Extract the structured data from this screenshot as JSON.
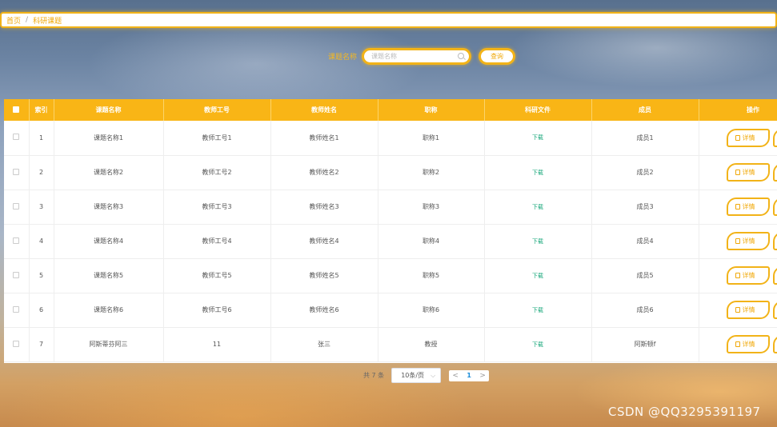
{
  "breadcrumb": {
    "home": "首页",
    "separator": "/",
    "current": "科研课题"
  },
  "search": {
    "label": "课题名称",
    "placeholder": "课题名称",
    "value": "",
    "button": "查询"
  },
  "table": {
    "headers": [
      "索引",
      "课题名称",
      "教师工号",
      "教师姓名",
      "职称",
      "科研文件",
      "成员",
      "操作"
    ],
    "rows": [
      {
        "index": "1",
        "name": "课题名称1",
        "teacher_id": "教师工号1",
        "teacher_name": "教师姓名1",
        "title": "职称1",
        "file": "下载",
        "members": "成员1",
        "detail": "详情"
      },
      {
        "index": "2",
        "name": "课题名称2",
        "teacher_id": "教师工号2",
        "teacher_name": "教师姓名2",
        "title": "职称2",
        "file": "下载",
        "members": "成员2",
        "detail": "详情"
      },
      {
        "index": "3",
        "name": "课题名称3",
        "teacher_id": "教师工号3",
        "teacher_name": "教师姓名3",
        "title": "职称3",
        "file": "下载",
        "members": "成员3",
        "detail": "详情"
      },
      {
        "index": "4",
        "name": "课题名称4",
        "teacher_id": "教师工号4",
        "teacher_name": "教师姓名4",
        "title": "职称4",
        "file": "下载",
        "members": "成员4",
        "detail": "详情"
      },
      {
        "index": "5",
        "name": "课题名称5",
        "teacher_id": "教师工号5",
        "teacher_name": "教师姓名5",
        "title": "职称5",
        "file": "下载",
        "members": "成员5",
        "detail": "详情"
      },
      {
        "index": "6",
        "name": "课题名称6",
        "teacher_id": "教师工号6",
        "teacher_name": "教师姓名6",
        "title": "职称6",
        "file": "下载",
        "members": "成员6",
        "detail": "详情"
      },
      {
        "index": "7",
        "name": "阿斯蒂芬阿三",
        "teacher_id": "11",
        "teacher_name": "张三",
        "title": "教授",
        "file": "下载",
        "members": "阿斯顿f",
        "detail": "详情"
      }
    ]
  },
  "pagination": {
    "total": "共 7 条",
    "page_size": "10条/页",
    "prev": "<",
    "current_page": "1",
    "next": ">"
  },
  "watermark": "CSDN @QQ3295391197",
  "colors": {
    "accent": "#f9b516",
    "download": "#17a77a",
    "page_active": "#1a8cd8"
  }
}
